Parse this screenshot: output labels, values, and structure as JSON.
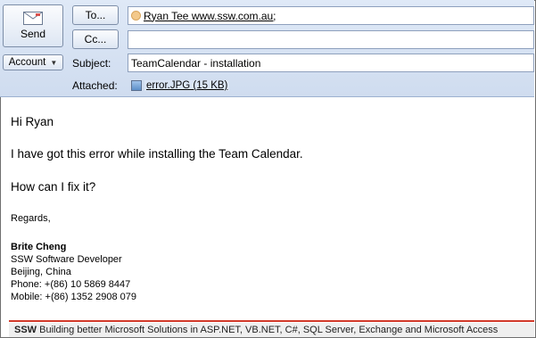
{
  "toolbar": {
    "send_label": "Send",
    "to_label": "To...",
    "cc_label": "Cc...",
    "account_label": "Account"
  },
  "fields": {
    "to_value": "Ryan Tee www.ssw.com.au;",
    "cc_value": "",
    "subject_label": "Subject:",
    "subject_value": "TeamCalendar - installation",
    "attached_label": "Attached:",
    "attachment": "error.JPG (15 KB)"
  },
  "message": {
    "greeting": "Hi Ryan",
    "line1": "I have got this error while installing the Team Calendar.",
    "line2": "How can I fix it?",
    "closing": "Regards,",
    "signature": {
      "name": "Brite Cheng",
      "title": "SSW Software Developer",
      "location": "Beijing, China",
      "phone": "Phone: +(86) 10 5869 8447",
      "mobile": "Mobile: +(86) 1352 2908 079"
    },
    "footer_brand": "SSW",
    "footer_text": " Building better Microsoft Solutions in ASP.NET, VB.NET, C#, SQL Server, Exchange and Microsoft Access"
  },
  "icons": [
    "send-envelope-icon",
    "recipient-icon",
    "attachment-image-icon",
    "dropdown-caret-icon"
  ],
  "colors": {
    "footer_rule": "#d23a2a",
    "header_bg": "#dfe9f7"
  }
}
